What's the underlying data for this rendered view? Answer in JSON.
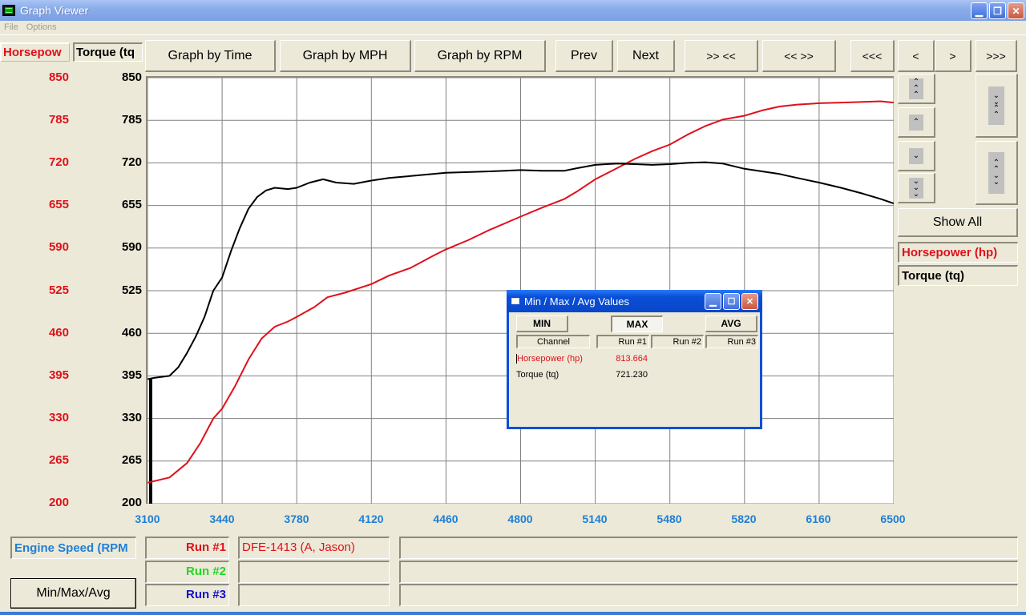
{
  "window": {
    "title": "Graph Viewer",
    "controls": [
      "minimize",
      "restore",
      "close"
    ]
  },
  "menu": [
    "File",
    "Options"
  ],
  "axis_tabs": [
    {
      "label": "Horsepow",
      "color": "#e0101a"
    },
    {
      "label": "Torque (tq",
      "color": "#000000"
    }
  ],
  "toolbar": {
    "graph_by_time": "Graph by Time",
    "graph_by_mph": "Graph by MPH",
    "graph_by_rpm": "Graph by RPM",
    "prev": "Prev",
    "next": "Next",
    "zoom_in": ">> <<",
    "zoom_out": "<< >>",
    "first": "<<<",
    "step_back": "<",
    "step_fwd": ">",
    "last": ">>>"
  },
  "right_panel": {
    "scroll_top": "⌃⌃⌃",
    "scroll_up": "⌃",
    "scroll_down": "⌄",
    "scroll_bottom": "⌄⌄⌄",
    "show_all": "Show All",
    "legend": [
      {
        "label": "Horsepower (hp)",
        "color": "#e0101a"
      },
      {
        "label": "Torque (tq)",
        "color": "#000000"
      }
    ]
  },
  "chart_data": {
    "type": "line",
    "title": "",
    "xlabel": "Engine Speed (RPM",
    "xlim": [
      3100,
      6500
    ],
    "x_ticks": [
      "3100",
      "3440",
      "3780",
      "4120",
      "4460",
      "4800",
      "5140",
      "5480",
      "5820",
      "6160",
      "6500"
    ],
    "y_left": {
      "label": "Horsepow",
      "ylim": [
        200,
        850
      ],
      "ticks": [
        "850",
        "785",
        "720",
        "655",
        "590",
        "525",
        "460",
        "395",
        "330",
        "265",
        "200"
      ],
      "color": "#e0101a"
    },
    "y_right": {
      "label": "Torque (tq",
      "ylim": [
        200,
        850
      ],
      "ticks": [
        "850",
        "785",
        "720",
        "655",
        "590",
        "525",
        "460",
        "395",
        "330",
        "265",
        "200"
      ],
      "color": "#000000"
    },
    "grid": true,
    "series": [
      {
        "name": "Horsepower (hp)",
        "color": "#e0101a",
        "x": [
          3100,
          3200,
          3280,
          3340,
          3400,
          3440,
          3500,
          3560,
          3620,
          3680,
          3740,
          3780,
          3860,
          3920,
          4000,
          4120,
          4200,
          4300,
          4400,
          4460,
          4560,
          4660,
          4800,
          4900,
          5000,
          5060,
          5140,
          5240,
          5320,
          5400,
          5480,
          5560,
          5640,
          5720,
          5820,
          5900,
          5980,
          6060,
          6160,
          6260,
          6360,
          6440,
          6500
        ],
        "y": [
          232,
          240,
          262,
          292,
          330,
          345,
          380,
          420,
          452,
          470,
          478,
          485,
          500,
          515,
          522,
          535,
          548,
          560,
          578,
          588,
          602,
          618,
          638,
          652,
          665,
          677,
          695,
          712,
          726,
          738,
          748,
          763,
          776,
          786,
          792,
          800,
          806,
          809,
          811,
          812,
          813,
          814,
          812
        ]
      },
      {
        "name": "Torque (tq)",
        "color": "#000000",
        "x": [
          3100,
          3130,
          3200,
          3240,
          3280,
          3320,
          3360,
          3400,
          3440,
          3480,
          3520,
          3560,
          3600,
          3640,
          3680,
          3740,
          3780,
          3840,
          3900,
          3960,
          4040,
          4120,
          4200,
          4300,
          4400,
          4460,
          4560,
          4660,
          4800,
          4900,
          5000,
          5060,
          5140,
          5240,
          5320,
          5400,
          5480,
          5560,
          5640,
          5720,
          5820,
          5900,
          5980,
          6060,
          6160,
          6260,
          6360,
          6440,
          6500
        ],
        "y": [
          390,
          392,
          395,
          408,
          430,
          455,
          485,
          525,
          545,
          585,
          620,
          650,
          668,
          678,
          682,
          680,
          682,
          690,
          695,
          690,
          688,
          693,
          697,
          700,
          703,
          705,
          706,
          707,
          709,
          708,
          708,
          712,
          717,
          719,
          718,
          717,
          718,
          720,
          721,
          719,
          711,
          707,
          703,
          697,
          690,
          682,
          673,
          665,
          658
        ]
      }
    ]
  },
  "footer": {
    "x_channel": "Engine Speed (RPM",
    "x_channel_color": "#1f7fd6",
    "minmax_button": "Min/Max/Avg",
    "runs": [
      {
        "label": "Run #1",
        "color": "#e0101a",
        "name": "DFE-1413 (A, Jason)",
        "extra": ""
      },
      {
        "label": "Run #2",
        "color": "#22d822",
        "name": "",
        "extra": ""
      },
      {
        "label": "Run #3",
        "color": "#1010c8",
        "name": "",
        "extra": ""
      }
    ]
  },
  "minmax_dialog": {
    "title": "Min / Max / Avg Values",
    "buttons": {
      "min": "MIN",
      "max": "MAX",
      "avg": "AVG"
    },
    "selected": "MAX",
    "headers": [
      "Channel",
      "Run #1",
      "Run #2",
      "Run #3"
    ],
    "rows": [
      {
        "channel": "Horsepower (hp)",
        "color": "#e0101a",
        "run1": "813.664",
        "run2": "",
        "run3": ""
      },
      {
        "channel": "Torque (tq)",
        "color": "#000000",
        "run1": "721.230",
        "run2": "",
        "run3": ""
      }
    ]
  }
}
